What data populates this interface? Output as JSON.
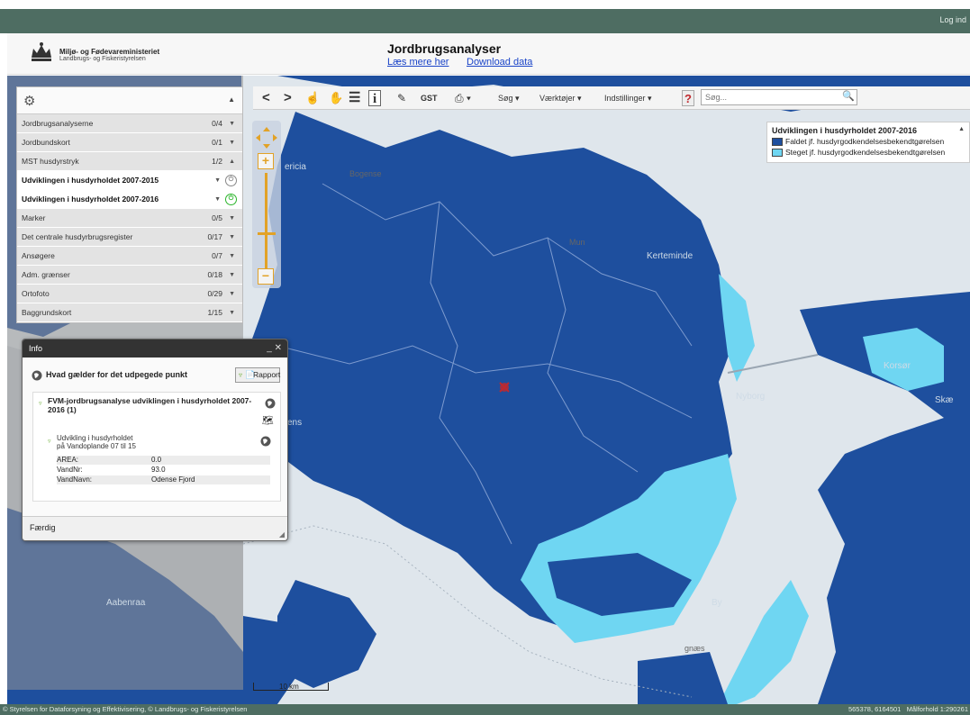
{
  "header": {
    "login": "Log ind",
    "ministry_name": "Miljø- og Fødevareministeriet",
    "agency_name": "Landbrugs- og Fiskeristyrelsen",
    "app_title": "Jordbrugsanalyser",
    "read_more_link": "Læs mere her",
    "download_link": "Download data"
  },
  "layer_panel": {
    "items": [
      {
        "label": "Jordbrugsanalyserne",
        "count": "0/4",
        "state": "collapsed"
      },
      {
        "label": "Jordbundskort",
        "count": "0/1",
        "state": "collapsed"
      },
      {
        "label": "MST husdyrstryk",
        "count": "1/2",
        "state": "expanded"
      },
      {
        "label": "Udviklingen i husdyrholdet 2007-2015",
        "count": "",
        "state": "off"
      },
      {
        "label": "Udviklingen i husdyrholdet 2007-2016",
        "count": "",
        "state": "on"
      },
      {
        "label": "Marker",
        "count": "0/5",
        "state": "collapsed"
      },
      {
        "label": "Det centrale husdyrbrugsregister",
        "count": "0/17",
        "state": "collapsed"
      },
      {
        "label": "Ansøgere",
        "count": "0/7",
        "state": "collapsed"
      },
      {
        "label": "Adm. grænser",
        "count": "0/18",
        "state": "collapsed"
      },
      {
        "label": "Ortofoto",
        "count": "0/29",
        "state": "collapsed"
      },
      {
        "label": "Baggrundskort",
        "count": "1/15",
        "state": "collapsed"
      }
    ]
  },
  "toolbar": {
    "gst": "GST",
    "search_menu": "Søg",
    "tools_menu": "Værktøjer",
    "settings_menu": "Indstillinger",
    "search_placeholder": "Søg..."
  },
  "legend": {
    "title": "Udviklingen i husdyrholdet 2007-2016",
    "entries": [
      {
        "label": "Faldet jf. husdyrgodkendelsesbekendtgørelsen",
        "color": "#1e4f9e"
      },
      {
        "label": "Steget jf. husdyrgodkendelsesbekendtgørelsen",
        "color": "#6fd6f2"
      }
    ]
  },
  "info_window": {
    "title": "Info",
    "question": "Hvad gælder for det udpegede punkt",
    "report_button": "Rapport",
    "result_title": "FVM-jordbrugsanalyse udviklingen i husdyrholdet 2007-2016 (1)",
    "sub_title_line1": "Udvikling i husdyrholdet",
    "sub_title_line2": "på Vandoplande 07 til 15",
    "attributes": [
      {
        "key": "AREA:",
        "value": "0.0"
      },
      {
        "key": "VandNr:",
        "value": "93.0"
      },
      {
        "key": "VandNavn:",
        "value": "Odense Fjord"
      }
    ],
    "done": "Færdig"
  },
  "map": {
    "places": {
      "ericia": "ericia",
      "bogense": "Bogense",
      "kerteminde": "Kerteminde",
      "korsor": "Korsør",
      "nyborg": "Nyborg",
      "aabenraa": "Aabenraa",
      "by": "By",
      "mun": "Mun",
      "ens": "ens",
      "skae": "Skæ",
      "gnaes": "gnæs"
    },
    "colors": {
      "decrease": "#1e4f9e",
      "increase": "#6fd6f2",
      "background": "#dfe6ec",
      "accent": "#e2a227"
    },
    "scale_label": "10 km"
  },
  "footer": {
    "copyright": "© Styrelsen for Dataforsyning og Effektivisering, © Landbrugs- og Fiskeristyrelsen",
    "coordinates": "565378, 6164501",
    "scale": "Målforhold 1:290261"
  }
}
